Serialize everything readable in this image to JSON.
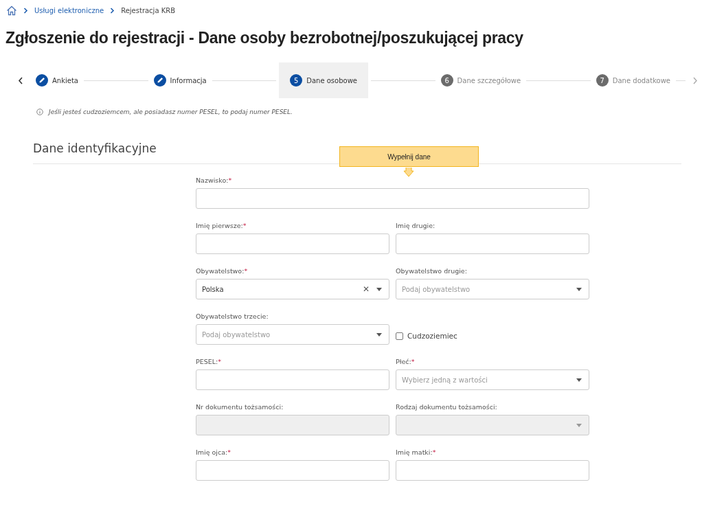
{
  "breadcrumb": [
    {
      "label": "Usługi elektroniczne",
      "kind": "link"
    },
    {
      "label": "Rejestracja KRB",
      "kind": "current"
    }
  ],
  "title": "Zgłoszenie do rejestracji - Dane osoby bezrobotnej/poszukującej pracy",
  "steps": [
    {
      "label": "Ankieta",
      "kind": "done",
      "selected": false
    },
    {
      "label": "Informacja",
      "kind": "done",
      "selected": false
    },
    {
      "number": "5",
      "label": "Dane osobowe",
      "kind": "current",
      "selected": true
    },
    {
      "number": "6",
      "label": "Dane szczegółowe",
      "kind": "pending",
      "selected": false
    },
    {
      "number": "7",
      "label": "Dane dodatkowe",
      "kind": "pending",
      "selected": false
    }
  ],
  "info": "Jeśli jesteś cudzoziemcem, ale posiadasz numer PESEL, to podaj numer PESEL.",
  "section_title": "Dane identyfikacyjne",
  "tooltip": "Wypełnij dane",
  "rows": [
    [
      {
        "kind": "text",
        "label": "Nazwisko:",
        "required_mark": "*",
        "disabled": false
      }
    ],
    [
      {
        "kind": "text",
        "label": "Imię pierwsze:",
        "required_mark": "*",
        "disabled": false
      },
      {
        "kind": "text",
        "label": "Imię drugie:",
        "disabled": false
      }
    ],
    [
      {
        "kind": "select",
        "label": "Obywatelstwo:",
        "required_mark": "*",
        "value": "Polska",
        "clear": "✕",
        "disabled": false
      },
      {
        "kind": "select",
        "label": "Obywatelstwo drugie:",
        "placeholder": "Podaj obywatelstwo",
        "disabled": false
      }
    ],
    [
      {
        "kind": "select",
        "label": "Obywatelstwo trzecie:",
        "placeholder": "Podaj obywatelstwo",
        "disabled": false
      },
      {
        "kind": "checkbox",
        "label": "Cudzoziemiec",
        "checked": false
      }
    ],
    [
      {
        "kind": "text",
        "label": "PESEL:",
        "required_mark": "*",
        "disabled": false
      },
      {
        "kind": "select",
        "label": "Płeć:",
        "required_mark": "*",
        "placeholder": "Wybierz jedną z wartości",
        "disabled": false
      }
    ],
    [
      {
        "kind": "text",
        "label": "Nr dokumentu tożsamości:",
        "disabled": true
      },
      {
        "kind": "select",
        "label": "Rodzaj dokumentu tożsamości:",
        "disabled": true
      }
    ],
    [
      {
        "kind": "text",
        "label": "Imię ojca:",
        "required_mark": "*",
        "disabled": false
      },
      {
        "kind": "text",
        "label": "Imię matki:",
        "required_mark": "*",
        "disabled": false
      }
    ]
  ]
}
